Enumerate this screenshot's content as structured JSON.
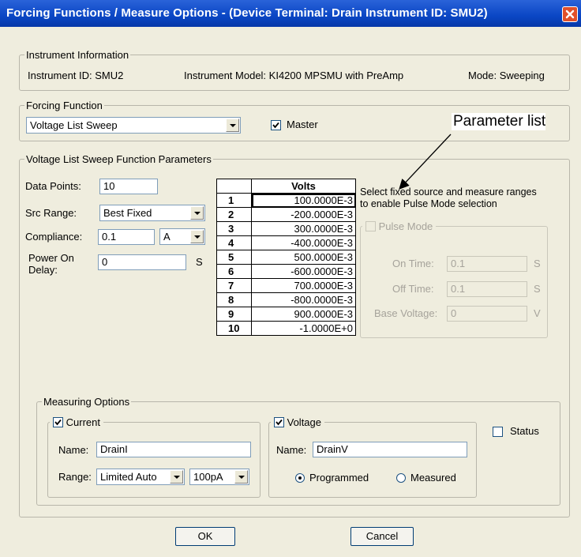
{
  "window": {
    "title": "Forcing Functions / Measure Options - (Device Terminal: Drain  Instrument ID: SMU2)"
  },
  "instrument_info": {
    "legend": "Instrument Information",
    "id_text": "Instrument ID:  SMU2",
    "model_text": "Instrument Model:  KI4200 MPSMU with PreAmp",
    "mode_text": "Mode:  Sweeping"
  },
  "forcing_function": {
    "legend": "Forcing Function",
    "selected": "Voltage List Sweep",
    "master_label": "Master",
    "master_checked": true
  },
  "parameters": {
    "legend": "Voltage List Sweep Function Parameters",
    "data_points_label": "Data Points:",
    "data_points_value": "10",
    "src_range_label": "Src Range:",
    "src_range_value": "Best Fixed",
    "compliance_label": "Compliance:",
    "compliance_value": "0.1",
    "compliance_unit": "A",
    "power_on_delay_label_1": "Power On",
    "power_on_delay_label_2": "Delay:",
    "power_on_delay_value": "0",
    "power_on_delay_unit": "S"
  },
  "volts_table": {
    "header": "Volts",
    "rows": [
      {
        "n": "1",
        "v": "100.0000E-3"
      },
      {
        "n": "2",
        "v": "-200.0000E-3"
      },
      {
        "n": "3",
        "v": "300.0000E-3"
      },
      {
        "n": "4",
        "v": "-400.0000E-3"
      },
      {
        "n": "5",
        "v": "500.0000E-3"
      },
      {
        "n": "6",
        "v": "-600.0000E-3"
      },
      {
        "n": "7",
        "v": "700.0000E-3"
      },
      {
        "n": "8",
        "v": "-800.0000E-3"
      },
      {
        "n": "9",
        "v": "900.0000E-3"
      },
      {
        "n": "10",
        "v": "-1.0000E+0"
      }
    ]
  },
  "pulse": {
    "note_line1": "Select fixed source and measure ranges",
    "note_line2": "to enable Pulse Mode selection",
    "pulse_mode_label": "Pulse Mode",
    "on_time_label": "On Time:",
    "on_time_value": "0.1",
    "on_time_unit": "S",
    "off_time_label": "Off Time:",
    "off_time_value": "0.1",
    "off_time_unit": "S",
    "base_voltage_label": "Base Voltage:",
    "base_voltage_value": "0",
    "base_voltage_unit": "V"
  },
  "measuring": {
    "legend": "Measuring Options",
    "current_label": "Current",
    "current_checked": true,
    "current_name_label": "Name:",
    "current_name_value": "DrainI",
    "range_label": "Range:",
    "range_mode": "Limited Auto",
    "range_value": "100pA",
    "voltage_label": "Voltage",
    "voltage_checked": true,
    "voltage_name_label": "Name:",
    "voltage_name_value": "DrainV",
    "programmed_label": "Programmed",
    "measured_label": "Measured",
    "status_label": "Status"
  },
  "buttons": {
    "ok": "OK",
    "cancel": "Cancel"
  },
  "annotation": {
    "text": "Parameter list"
  },
  "colors": {
    "titlebar": "#0a46c4",
    "dialog_bg": "#efedde",
    "close": "#e0502a"
  }
}
